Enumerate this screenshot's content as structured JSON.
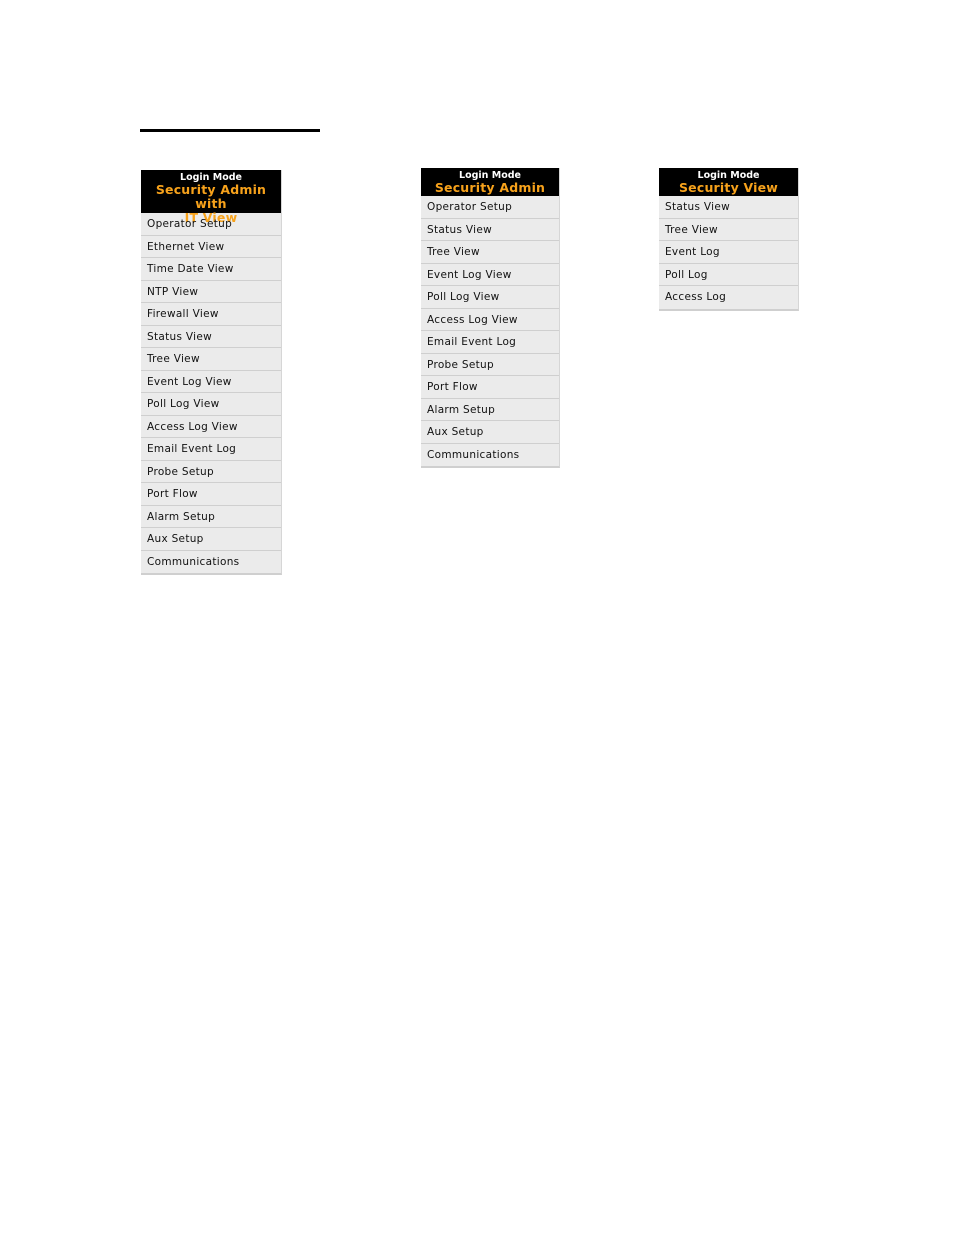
{
  "panels": [
    {
      "header_label": "Login Mode",
      "mode_line1": "Security Admin with",
      "mode_line2": "IT View",
      "items": [
        "Operator Setup",
        "Ethernet View",
        "Time Date View",
        "NTP View",
        "Firewall View",
        "Status View",
        "Tree View",
        "Event Log View",
        "Poll Log View",
        "Access Log View",
        "Email Event Log",
        "Probe Setup",
        "Port Flow",
        "Alarm Setup",
        "Aux Setup",
        "Communications"
      ]
    },
    {
      "header_label": "Login Mode",
      "mode_line1": "Security Admin",
      "items": [
        "Operator Setup",
        "Status View",
        "Tree View",
        "Event Log View",
        "Poll Log View",
        "Access Log View",
        "Email Event Log",
        "Probe Setup",
        "Port Flow",
        "Alarm Setup",
        "Aux Setup",
        "Communications"
      ]
    },
    {
      "header_label": "Login Mode",
      "mode_line1": "Security View",
      "items": [
        "Status View",
        "Tree View",
        "Event Log",
        "Poll Log",
        "Access Log"
      ]
    }
  ],
  "colors": {
    "header_bg": "#000000",
    "mode_text": "#f7a21b",
    "item_bg": "#ebebeb"
  }
}
